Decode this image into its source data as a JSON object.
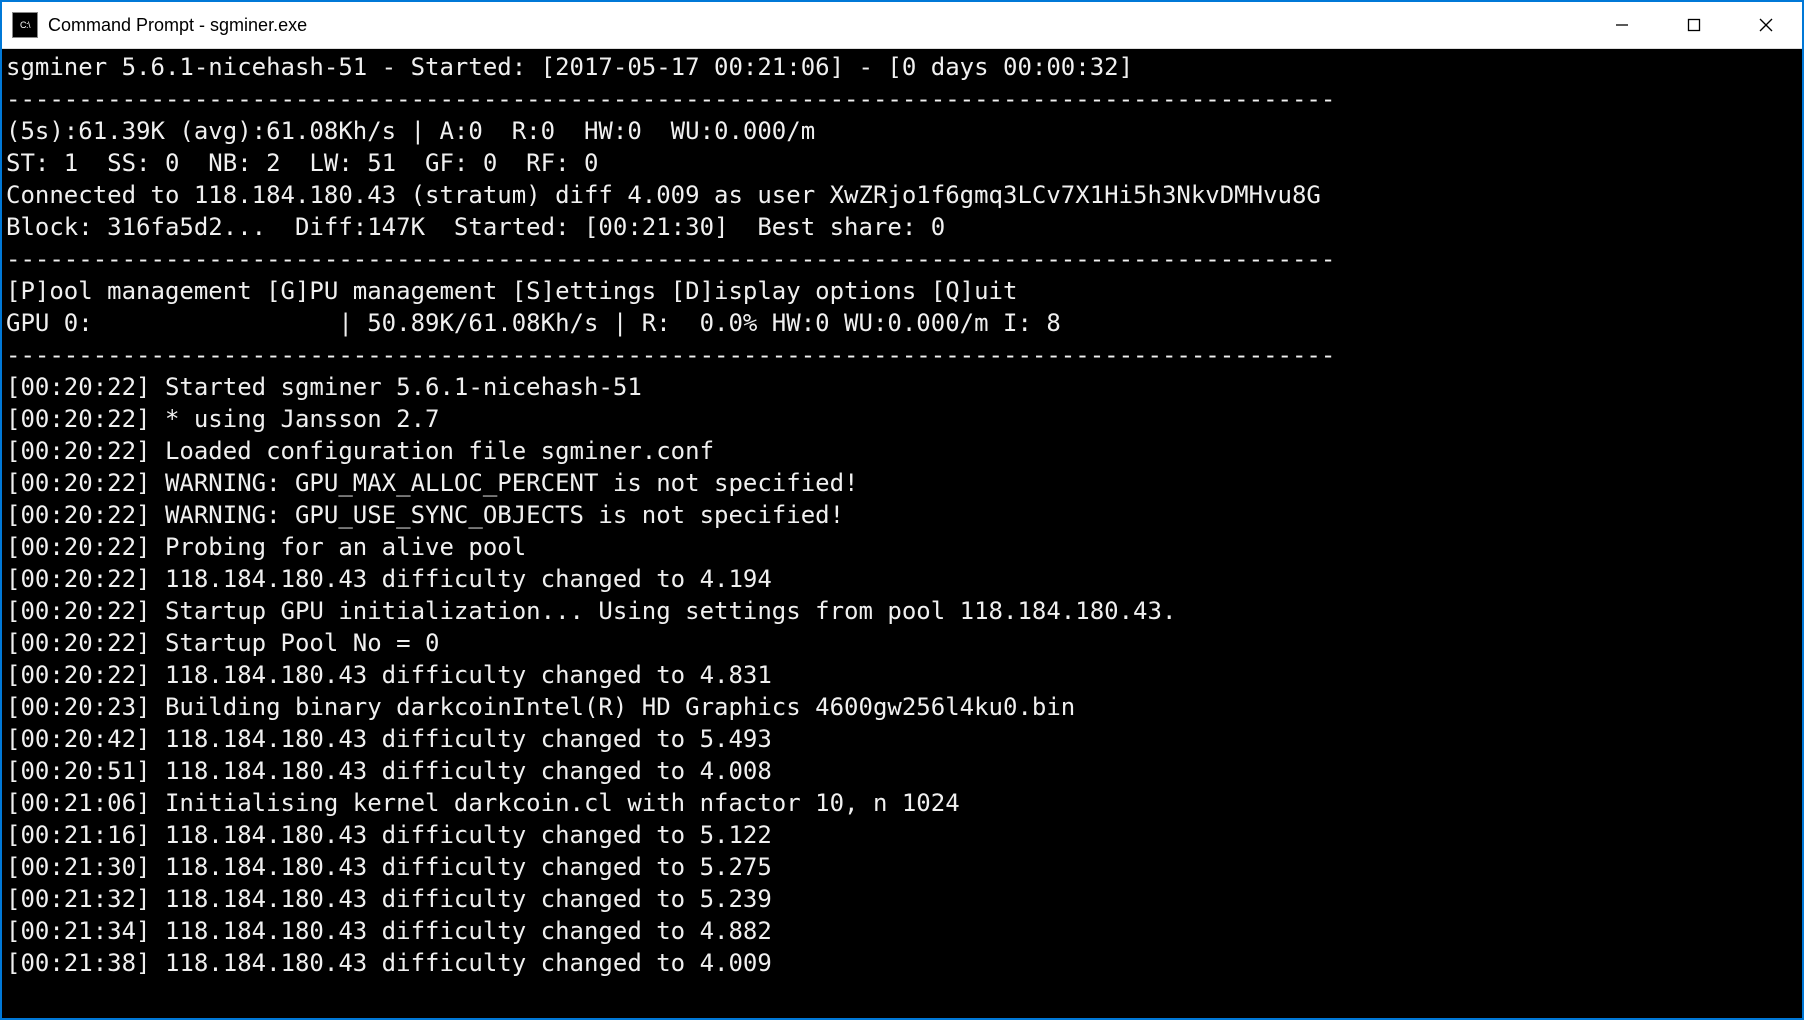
{
  "window": {
    "title": "Command Prompt - sgminer.exe",
    "icon_label": "C:\\"
  },
  "terminal": {
    "header_line": "sgminer 5.6.1-nicehash-51 - Started: [2017-05-17 00:21:06] - [0 days 00:00:32]",
    "divider": "--------------------------------------------------------------------------------------------",
    "stats_line": "(5s):61.39K (avg):61.08Kh/s | A:0  R:0  HW:0  WU:0.000/m",
    "st_line": "ST: 1  SS: 0  NB: 2  LW: 51  GF: 0  RF: 0",
    "connected_line": "Connected to 118.184.180.43 (stratum) diff 4.009 as user XwZRjo1f6gmq3LCv7X1Hi5h3NkvDMHvu8G",
    "block_line": "Block: 316fa5d2...  Diff:147K  Started: [00:21:30]  Best share: 0",
    "menu_line": "[P]ool management [G]PU management [S]ettings [D]isplay options [Q]uit",
    "gpu_line": "GPU 0:                 | 50.89K/61.08Kh/s | R:  0.0% HW:0 WU:0.000/m I: 8",
    "log": [
      "[00:20:22] Started sgminer 5.6.1-nicehash-51",
      "[00:20:22] * using Jansson 2.7",
      "[00:20:22] Loaded configuration file sgminer.conf",
      "[00:20:22] WARNING: GPU_MAX_ALLOC_PERCENT is not specified!",
      "[00:20:22] WARNING: GPU_USE_SYNC_OBJECTS is not specified!",
      "[00:20:22] Probing for an alive pool",
      "[00:20:22] 118.184.180.43 difficulty changed to 4.194",
      "[00:20:22] Startup GPU initialization... Using settings from pool 118.184.180.43.",
      "[00:20:22] Startup Pool No = 0",
      "[00:20:22] 118.184.180.43 difficulty changed to 4.831",
      "[00:20:23] Building binary darkcoinIntel(R) HD Graphics 4600gw256l4ku0.bin",
      "[00:20:42] 118.184.180.43 difficulty changed to 5.493",
      "[00:20:51] 118.184.180.43 difficulty changed to 4.008",
      "[00:21:06] Initialising kernel darkcoin.cl with nfactor 10, n 1024",
      "[00:21:16] 118.184.180.43 difficulty changed to 5.122",
      "[00:21:30] 118.184.180.43 difficulty changed to 5.275",
      "[00:21:32] 118.184.180.43 difficulty changed to 5.239",
      "[00:21:34] 118.184.180.43 difficulty changed to 4.882",
      "[00:21:38] 118.184.180.43 difficulty changed to 4.009"
    ]
  }
}
